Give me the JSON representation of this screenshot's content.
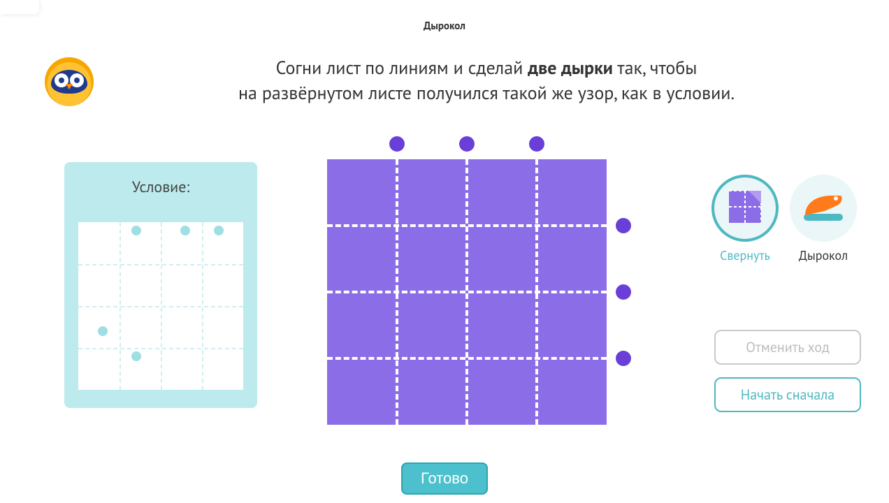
{
  "title": "Дырокол",
  "instruction": {
    "line1_pre": "Согни лист по линиям и сделай ",
    "line1_bold": "две дырки",
    "line1_post": " так, чтобы",
    "line2": "на развёрнутом листе получился такой же узор, как в условии."
  },
  "condition": {
    "label": "Условие:",
    "grid": {
      "cols": 4,
      "rows": 4
    },
    "dots": [
      {
        "cx": 1.4,
        "cy": 0.2
      },
      {
        "cx": 2.6,
        "cy": 0.2
      },
      {
        "cx": 3.4,
        "cy": 0.2
      },
      {
        "cx": 0.6,
        "cy": 2.6
      },
      {
        "cx": 1.4,
        "cy": 3.2
      }
    ]
  },
  "playfield": {
    "grid": {
      "cols": 4,
      "rows": 4
    },
    "targets": {
      "top": [
        1,
        2,
        3
      ],
      "right": [
        1,
        2,
        3
      ]
    }
  },
  "tools": {
    "fold": {
      "label": "Свернуть",
      "active": true
    },
    "punch": {
      "label": "Дырокол",
      "active": false
    }
  },
  "buttons": {
    "undo": "Отменить ход",
    "restart": "Начать сначала",
    "done": "Готово"
  }
}
